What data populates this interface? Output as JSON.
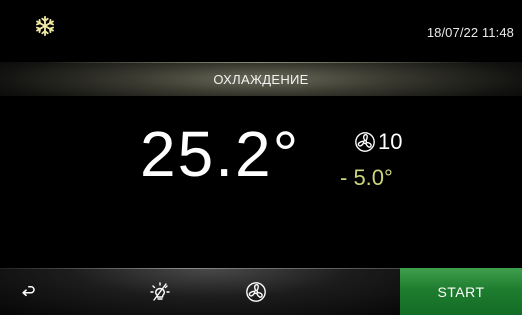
{
  "header": {
    "mode_icon": "snowflake-icon",
    "datetime": "18/07/22 11:48"
  },
  "mode": {
    "label": "ОХЛАЖДЕНИЕ"
  },
  "temperature": {
    "current": "25.2°",
    "fan_speed": "10",
    "fan_icon": "fan-icon",
    "setpoint": "- 5.0°"
  },
  "bottom_bar": {
    "back_icon": "back-arrow-icon",
    "light_icon": "light-off-icon",
    "fan_icon": "fan-icon",
    "start_label": "START"
  },
  "colors": {
    "accent_yellow": "#ccd57a",
    "start_green": "#1e7d2f",
    "background": "#000000"
  }
}
